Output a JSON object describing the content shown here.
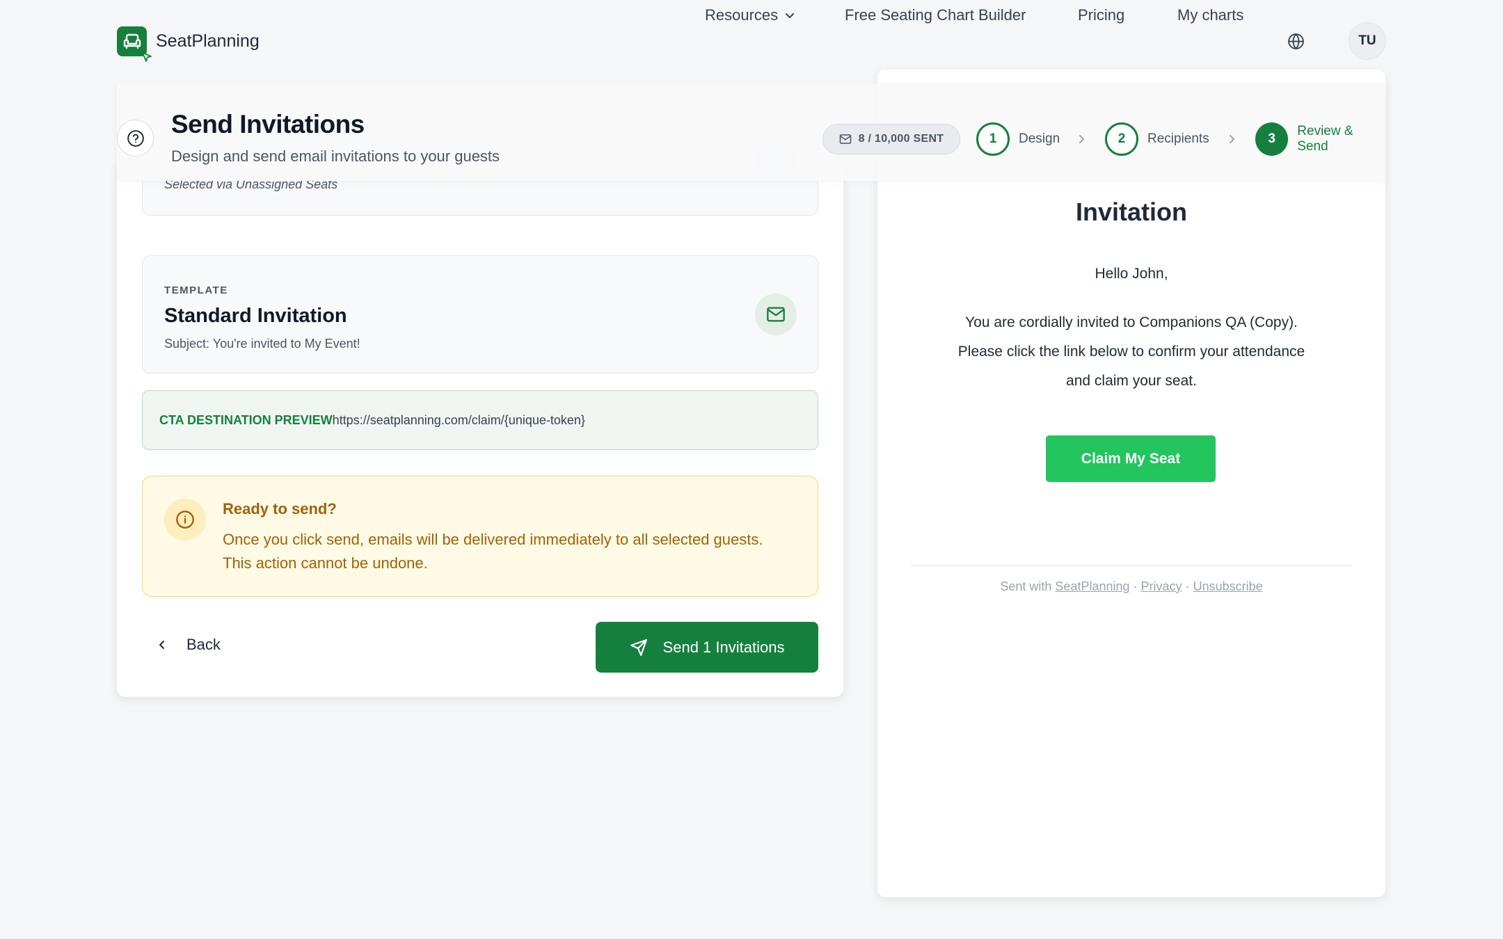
{
  "brand": {
    "name": "SeatPlanning",
    "accent": "#15803d"
  },
  "nav": {
    "resources": "Resources",
    "free_builder": "Free Seating Chart Builder",
    "pricing": "Pricing",
    "my_charts": "My charts",
    "avatar_initials": "TU"
  },
  "header": {
    "title": "Send Invitations",
    "subtitle": "Design and send email invitations to your guests",
    "sent_count": "8 / 10,000 SENT",
    "steps": [
      {
        "num": "1",
        "label": "Design",
        "state": "complete"
      },
      {
        "num": "2",
        "label": "Recipients",
        "state": "complete"
      },
      {
        "num": "3",
        "label": "Review & Send",
        "state": "active"
      }
    ]
  },
  "recipients": {
    "note": "Selected via Unassigned Seats"
  },
  "template": {
    "kicker": "TEMPLATE",
    "name": "Standard Invitation",
    "subject": "Subject: You're invited to My Event!"
  },
  "cta": {
    "label": "CTA DESTINATION PREVIEW",
    "url": "https://seatplanning.com/claim/{unique-token}"
  },
  "ready": {
    "title": "Ready to send?",
    "text": "Once you click send, emails will be delivered immediately to all selected guests. This action cannot be undone."
  },
  "actions": {
    "back": "Back",
    "send": "Send 1 Invitations"
  },
  "preview": {
    "heading": "Invitation",
    "greeting": "Hello John,",
    "message": "You are cordially invited to Companions QA (Copy). Please click the link below to confirm your attendance and claim your seat.",
    "button": "Claim My Seat",
    "footer_prefix": "Sent with",
    "footer_brand": "SeatPlanning",
    "footer_sep": "·",
    "footer_privacy": "Privacy",
    "footer_unsubscribe": "Unsubscribe"
  },
  "colors": {
    "primary": "#15803d",
    "cta_green": "#22c55e",
    "warning_text": "#a16207",
    "warning_bg": "#fefae6"
  }
}
